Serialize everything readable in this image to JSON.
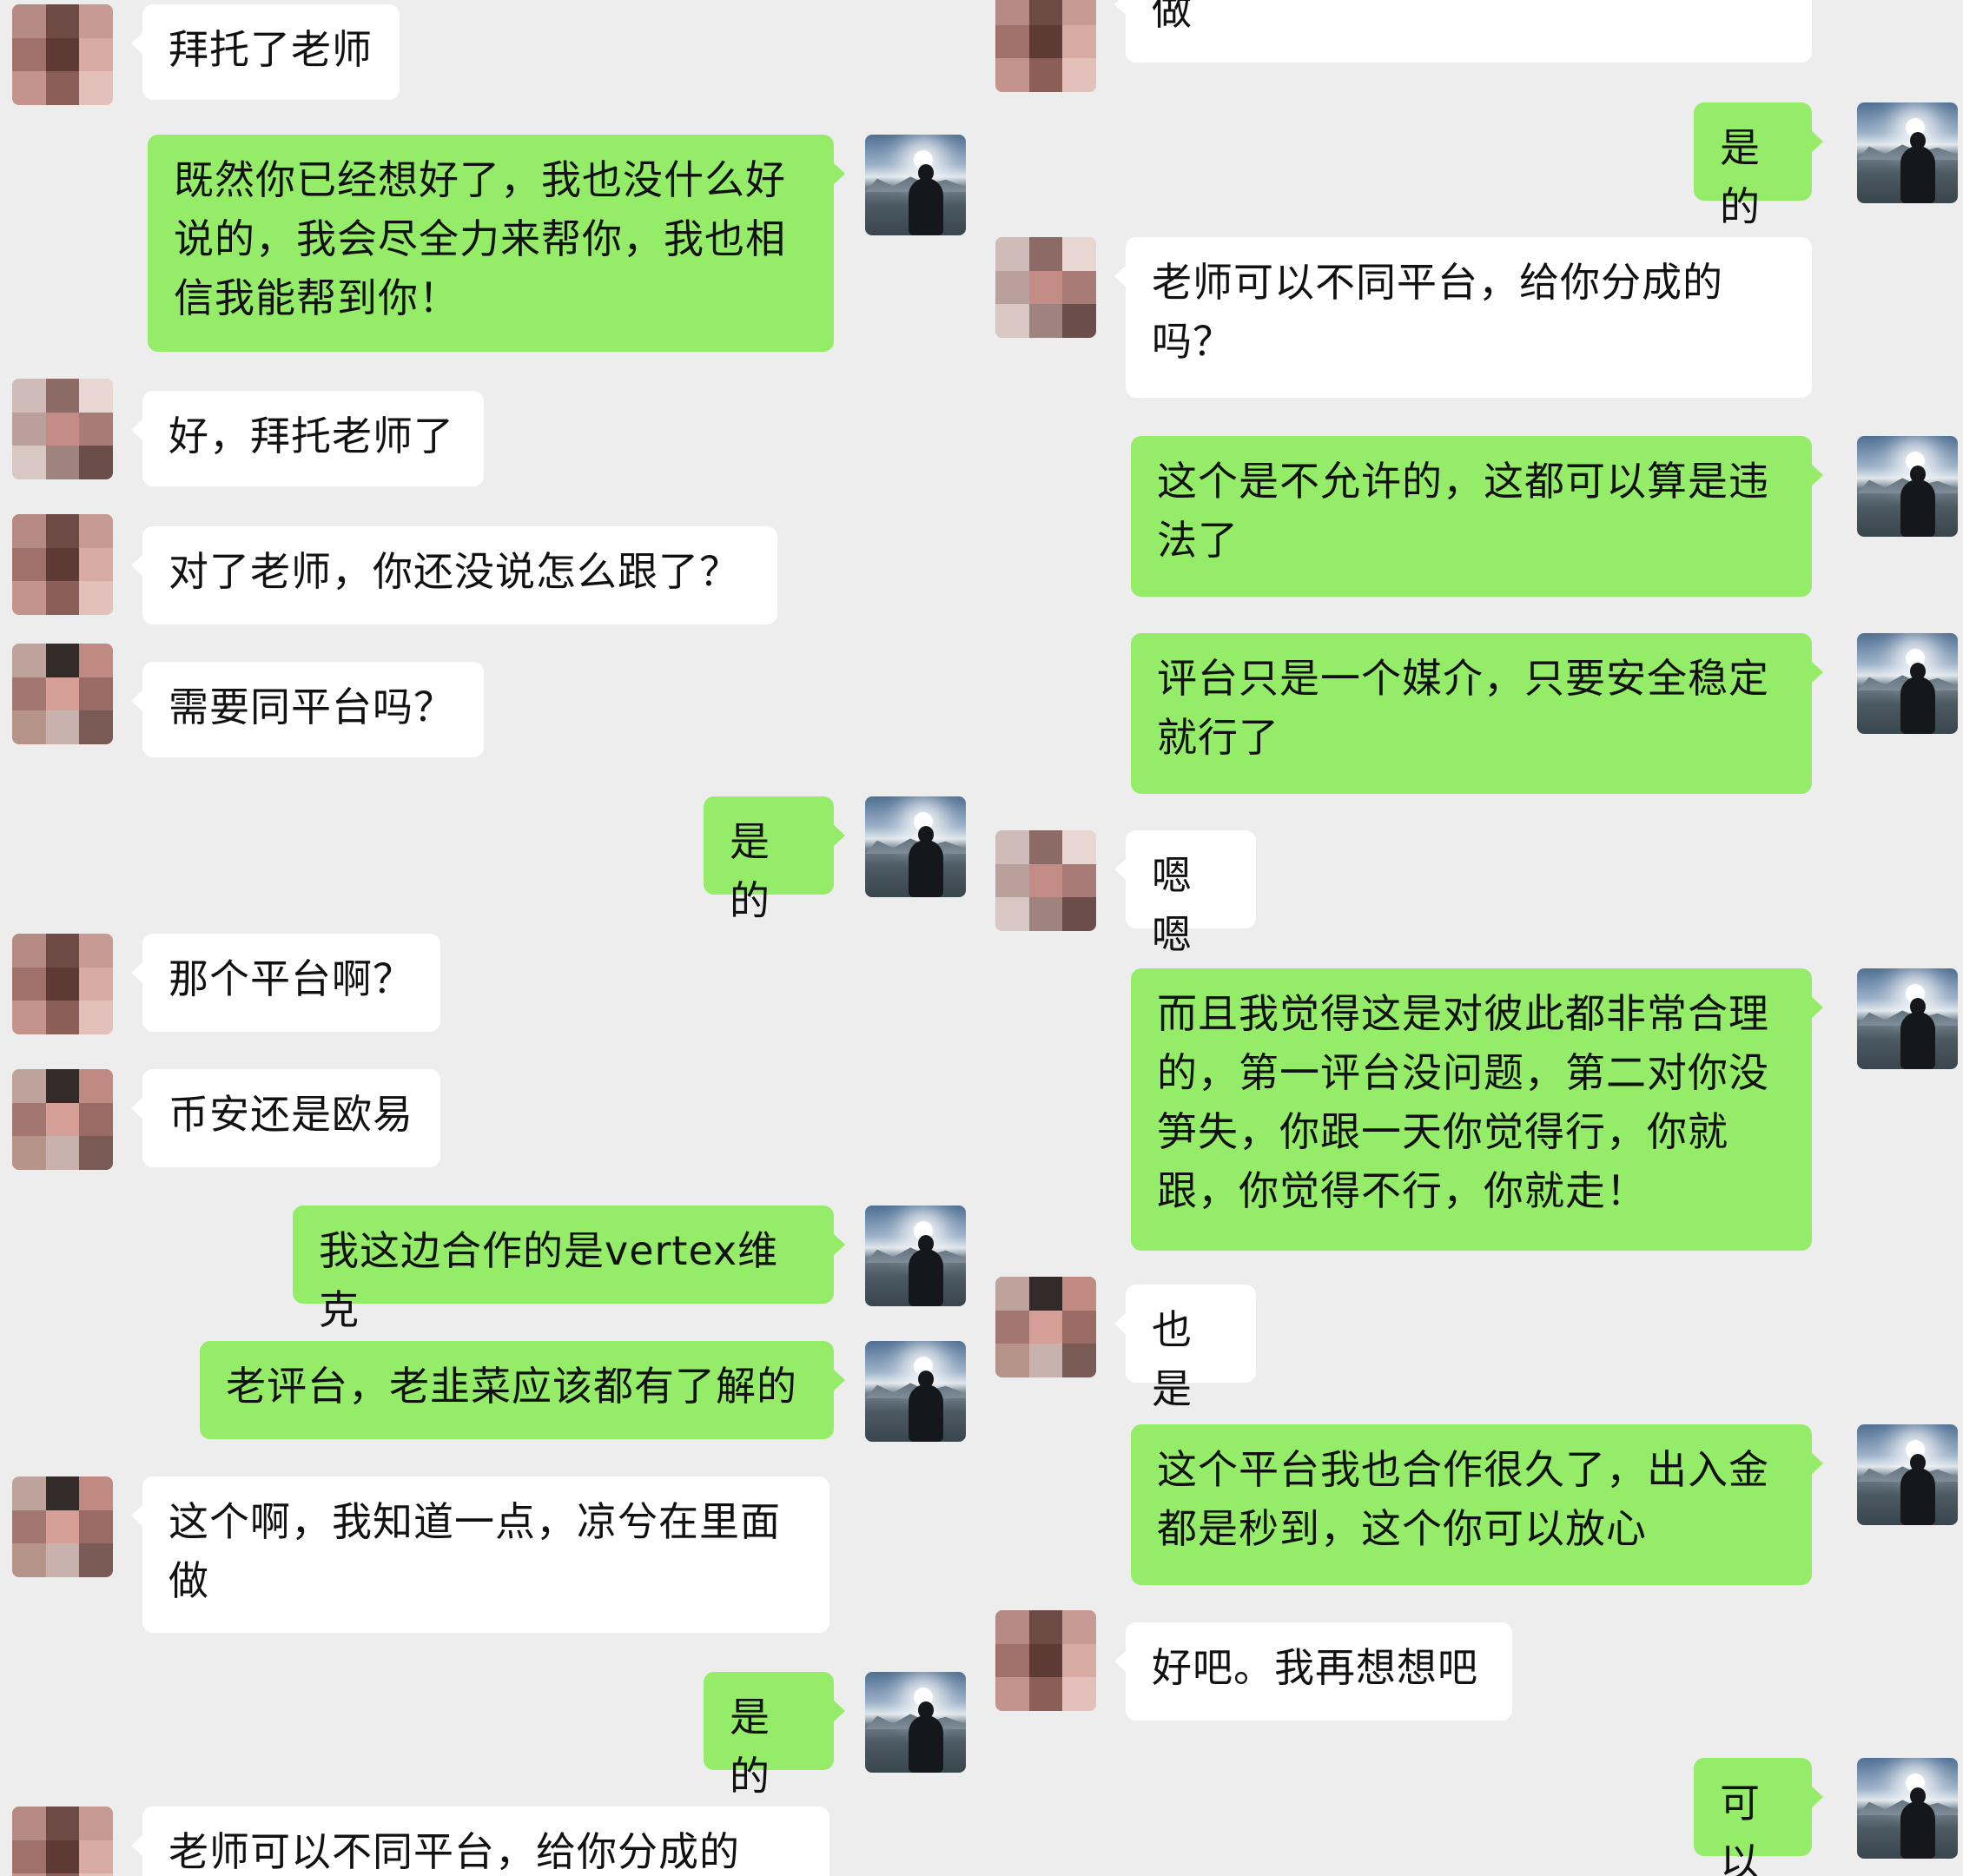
{
  "colors": {
    "background": "#ededed",
    "incoming_bubble": "#ffffff",
    "outgoing_bubble": "#95ec69"
  },
  "left_panel": {
    "messages": [
      {
        "sender": "other",
        "text": "拜托了老师"
      },
      {
        "sender": "self",
        "text": "既然你已经想好了，我也没什么好\n说的，我会尽全力来帮你，我也相\n信我能帮到你！"
      },
      {
        "sender": "other",
        "text": "好，拜托老师了"
      },
      {
        "sender": "other",
        "text": "对了老师，你还没说怎么跟了？"
      },
      {
        "sender": "other",
        "text": "需要同平台吗？"
      },
      {
        "sender": "self",
        "text": "是的"
      },
      {
        "sender": "other",
        "text": "那个平台啊？"
      },
      {
        "sender": "other",
        "text": "币安还是欧易"
      },
      {
        "sender": "self",
        "text": "我这边合作的是vertex维克"
      },
      {
        "sender": "self",
        "text": "老评台，老韭菜应该都有了解的"
      },
      {
        "sender": "other",
        "text": "这个啊，我知道一点，凉兮在里面\n做"
      },
      {
        "sender": "self",
        "text": "是的"
      },
      {
        "sender": "other",
        "text": "老师可以不同平台，给你分成的"
      }
    ]
  },
  "right_panel": {
    "messages": [
      {
        "sender": "other",
        "text": "做"
      },
      {
        "sender": "self",
        "text": "是的"
      },
      {
        "sender": "other",
        "text": "老师可以不同平台，给你分成的\n吗？"
      },
      {
        "sender": "self",
        "text": "这个是不允许的，这都可以算是违\n法了"
      },
      {
        "sender": "self",
        "text": "评台只是一个媒介，只要安全稳定\n就行了"
      },
      {
        "sender": "other",
        "text": "嗯嗯"
      },
      {
        "sender": "self",
        "text": "而且我觉得这是对彼此都非常合理\n的，第一评台没问题，第二对你没\n笋失，你跟一天你觉得行，你就\n跟，你觉得不行，你就走！"
      },
      {
        "sender": "other",
        "text": "也是"
      },
      {
        "sender": "self",
        "text": "这个平台我也合作很久了，出入金\n都是秒到，这个你可以放心"
      },
      {
        "sender": "other",
        "text": "好吧。我再想想吧"
      },
      {
        "sender": "self",
        "text": "可以"
      }
    ]
  }
}
